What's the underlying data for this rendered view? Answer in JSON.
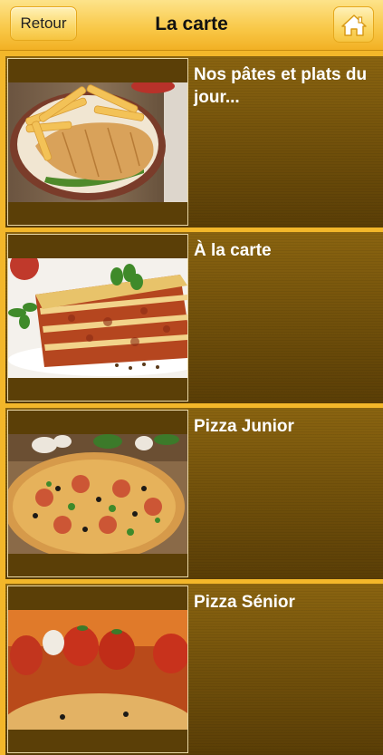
{
  "navbar": {
    "back_label": "Retour",
    "title": "La carte",
    "home_icon": "home-icon"
  },
  "menu": {
    "items": [
      {
        "label": "Nos pâtes et plats du jour...",
        "image": "schnitzel-fries-photo"
      },
      {
        "label": "À la carte",
        "image": "lasagna-photo"
      },
      {
        "label": "Pizza Junior",
        "image": "pizza-photo"
      },
      {
        "label": "Pizza Sénior",
        "image": "pizza-tomatoes-photo"
      }
    ]
  },
  "colors": {
    "navbar_yellow": "#f9c94a",
    "row_brown": "#6e4f0b",
    "separator_gold": "#f3b72a"
  }
}
